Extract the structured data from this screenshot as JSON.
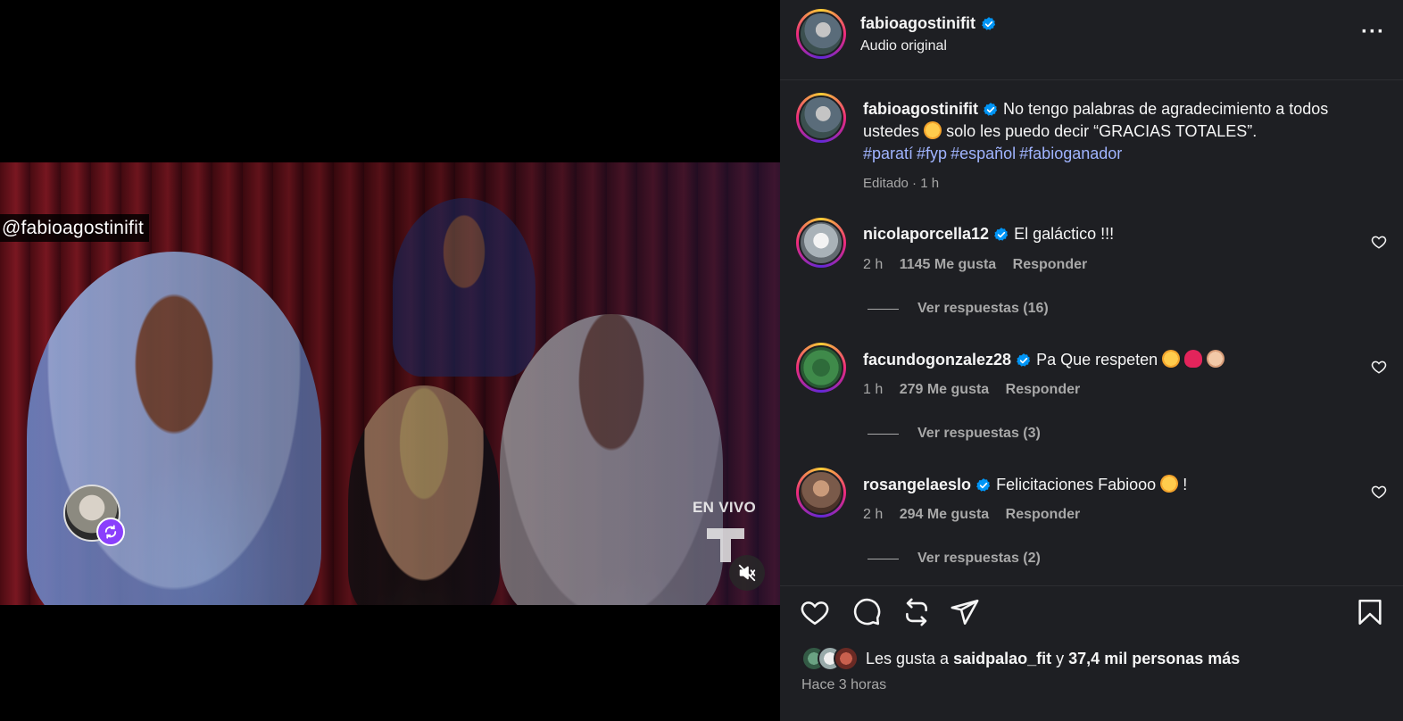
{
  "video": {
    "user_tag": "@fabioagostinifit",
    "live_label": "EN VIVO"
  },
  "header": {
    "username": "fabioagostinifit",
    "subtitle": "Audio original",
    "more_label": "···"
  },
  "caption": {
    "username": "fabioagostinifit",
    "text_part1": "No tengo palabras de agradecimiento a todos ustedes",
    "text_part2": "solo les puedo decir “GRACIAS TOTALES”.",
    "hashtags": [
      "#paratí",
      "#fyp",
      "#español",
      "#fabioganador"
    ],
    "meta": "Editado · 1 h"
  },
  "comments": [
    {
      "username": "nicolaporcella12",
      "text": "El galáctico !!!",
      "time": "2 h",
      "likes": "1145 Me gusta",
      "reply_label": "Responder",
      "replies_label": "Ver respuestas (16)"
    },
    {
      "username": "facundogonzalez28",
      "text": "Pa Que respeten",
      "time": "1 h",
      "likes": "279 Me gusta",
      "reply_label": "Responder",
      "replies_label": "Ver respuestas (3)"
    },
    {
      "username": "rosangelaeslo",
      "text": "Felicitaciones Fabiooo",
      "text_suffix": "!",
      "time": "2 h",
      "likes": "294 Me gusta",
      "reply_label": "Responder",
      "replies_label": "Ver respuestas (2)"
    }
  ],
  "likes_summary": {
    "prefix": "Les gusta a",
    "user": "saidpalao_fit",
    "middle": "y",
    "others": "37,4 mil personas más"
  },
  "posted_time": "Hace 3 horas",
  "colors": {
    "panel_bg": "#1e1f23",
    "hashtag": "#a0b4ff",
    "verified": "#0095f6",
    "muted_text": "#a8a8a8"
  },
  "icons": [
    "verified-icon",
    "more-icon",
    "heart-icon",
    "comment-icon",
    "repost-icon",
    "share-icon",
    "bookmark-icon",
    "mute-icon",
    "remix-icon"
  ]
}
